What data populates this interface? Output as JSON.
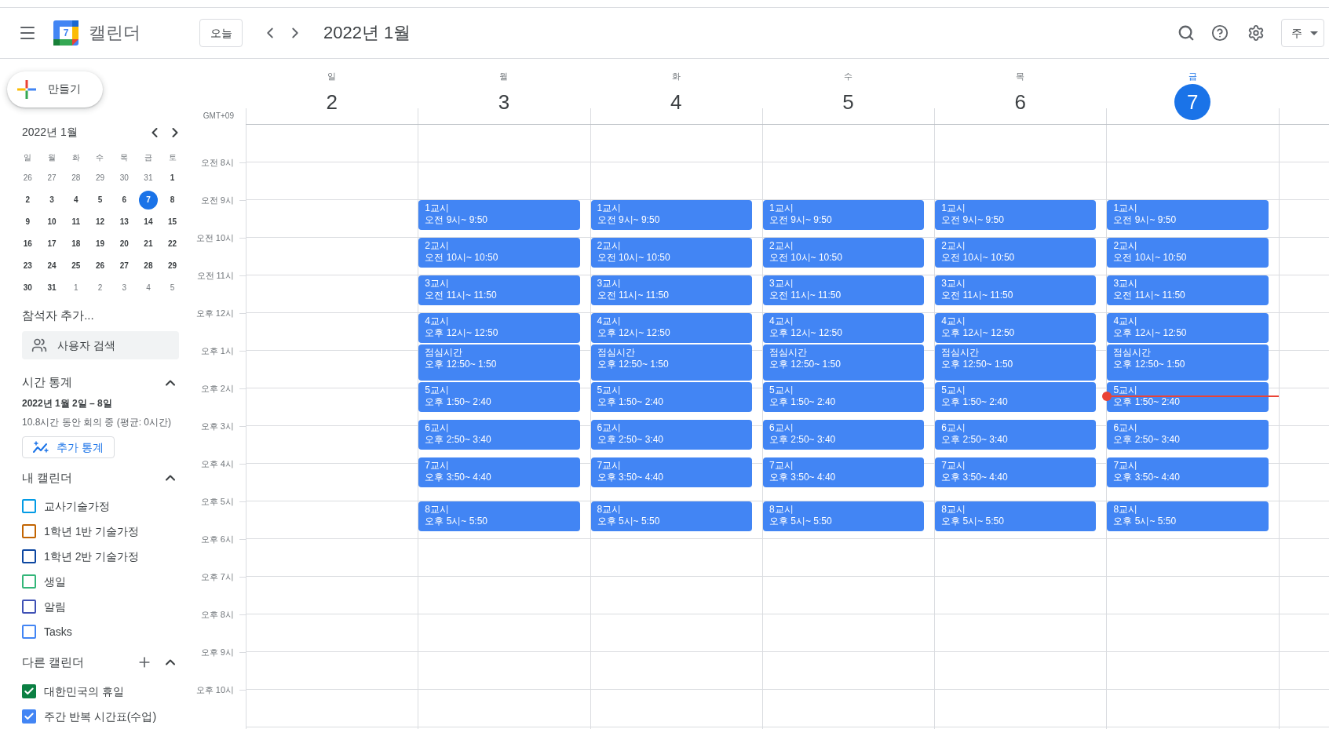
{
  "header": {
    "logo_day": "7",
    "app_name": "캘린더",
    "today_button": "오늘",
    "period": "2022년 1월",
    "view_selector": "주"
  },
  "sidebar": {
    "create_button": "만들기",
    "mini_calendar": {
      "title": "2022년 1월",
      "weekdays": [
        "일",
        "월",
        "화",
        "수",
        "목",
        "금",
        "토"
      ],
      "weeks": [
        [
          {
            "day": "26",
            "in_month": false,
            "selected": false
          },
          {
            "day": "27",
            "in_month": false,
            "selected": false
          },
          {
            "day": "28",
            "in_month": false,
            "selected": false
          },
          {
            "day": "29",
            "in_month": false,
            "selected": false
          },
          {
            "day": "30",
            "in_month": false,
            "selected": false
          },
          {
            "day": "31",
            "in_month": false,
            "selected": false
          },
          {
            "day": "1",
            "in_month": true,
            "selected": false
          }
        ],
        [
          {
            "day": "2",
            "in_month": true,
            "selected": false
          },
          {
            "day": "3",
            "in_month": true,
            "selected": false
          },
          {
            "day": "4",
            "in_month": true,
            "selected": false
          },
          {
            "day": "5",
            "in_month": true,
            "selected": false
          },
          {
            "day": "6",
            "in_month": true,
            "selected": false
          },
          {
            "day": "7",
            "in_month": true,
            "selected": true
          },
          {
            "day": "8",
            "in_month": true,
            "selected": false
          }
        ],
        [
          {
            "day": "9",
            "in_month": true,
            "selected": false
          },
          {
            "day": "10",
            "in_month": true,
            "selected": false
          },
          {
            "day": "11",
            "in_month": true,
            "selected": false
          },
          {
            "day": "12",
            "in_month": true,
            "selected": false
          },
          {
            "day": "13",
            "in_month": true,
            "selected": false
          },
          {
            "day": "14",
            "in_month": true,
            "selected": false
          },
          {
            "day": "15",
            "in_month": true,
            "selected": false
          }
        ],
        [
          {
            "day": "16",
            "in_month": true,
            "selected": false
          },
          {
            "day": "17",
            "in_month": true,
            "selected": false
          },
          {
            "day": "18",
            "in_month": true,
            "selected": false
          },
          {
            "day": "19",
            "in_month": true,
            "selected": false
          },
          {
            "day": "20",
            "in_month": true,
            "selected": false
          },
          {
            "day": "21",
            "in_month": true,
            "selected": false
          },
          {
            "day": "22",
            "in_month": true,
            "selected": false
          }
        ],
        [
          {
            "day": "23",
            "in_month": true,
            "selected": false
          },
          {
            "day": "24",
            "in_month": true,
            "selected": false
          },
          {
            "day": "25",
            "in_month": true,
            "selected": false
          },
          {
            "day": "26",
            "in_month": true,
            "selected": false
          },
          {
            "day": "27",
            "in_month": true,
            "selected": false
          },
          {
            "day": "28",
            "in_month": true,
            "selected": false
          },
          {
            "day": "29",
            "in_month": true,
            "selected": false
          }
        ],
        [
          {
            "day": "30",
            "in_month": true,
            "selected": false
          },
          {
            "day": "31",
            "in_month": true,
            "selected": false
          },
          {
            "day": "1",
            "in_month": false,
            "selected": false
          },
          {
            "day": "2",
            "in_month": false,
            "selected": false
          },
          {
            "day": "3",
            "in_month": false,
            "selected": false
          },
          {
            "day": "4",
            "in_month": false,
            "selected": false
          },
          {
            "day": "5",
            "in_month": false,
            "selected": false
          }
        ]
      ]
    },
    "people_search": {
      "title": "참석자 추가...",
      "placeholder": "사용자 검색"
    },
    "time_insights": {
      "title": "시간 통계",
      "expanded": true,
      "range": "2022년 1월 2일 – 8일",
      "summary": "10.8시간 동안 회의 중 (평균: 0시간)",
      "more_button": "추가 통계"
    },
    "my_calendars": {
      "title": "내 캘린더",
      "expanded": true,
      "items": [
        {
          "label": "교사기술가정",
          "color": "#039be5",
          "checked": false
        },
        {
          "label": "1학년 1반 기술가정",
          "color": "#c26401",
          "checked": false
        },
        {
          "label": "1학년 2반 기술가정",
          "color": "#0d47a1",
          "checked": false
        },
        {
          "label": "생일",
          "color": "#33b679",
          "checked": false
        },
        {
          "label": "알림",
          "color": "#3f51b5",
          "checked": false
        },
        {
          "label": "Tasks",
          "color": "#4285f4",
          "checked": false
        }
      ]
    },
    "other_calendars": {
      "title": "다른 캘린더",
      "expanded": true,
      "items": [
        {
          "label": "대한민국의 휴일",
          "color": "#0b8043",
          "checked": true
        },
        {
          "label": "주간 반복 시간표(수업)",
          "color": "#4285f4",
          "checked": true
        }
      ]
    }
  },
  "week_view": {
    "timezone": "GMT+09",
    "hours": [
      "오전 8시",
      "오전 9시",
      "오전 10시",
      "오전 11시",
      "오후 12시",
      "오후 1시",
      "오후 2시",
      "오후 3시",
      "오후 4시",
      "오후 5시",
      "오후 6시",
      "오후 7시",
      "오후 8시",
      "오후 9시",
      "오후 10시"
    ],
    "days": [
      {
        "weekday": "일",
        "date": "2",
        "today": false
      },
      {
        "weekday": "월",
        "date": "3",
        "today": false,
        "events": [
          {
            "title": "1교시",
            "time": "오전 9시~ 9:50"
          },
          {
            "title": "2교시",
            "time": "오전 10시~ 10:50"
          },
          {
            "title": "3교시",
            "time": "오전 11시~ 11:50"
          },
          {
            "title": "4교시",
            "time": "오후 12시~ 12:50"
          },
          {
            "title": "점심시간",
            "time": "오후 12:50~ 1:50"
          },
          {
            "title": "5교시",
            "time": "오후 1:50~ 2:40"
          },
          {
            "title": "6교시",
            "time": "오후 2:50~ 3:40"
          },
          {
            "title": "7교시",
            "time": "오후 3:50~ 4:40"
          },
          {
            "title": "8교시",
            "time": "오후 5시~ 5:50"
          }
        ]
      },
      {
        "weekday": "화",
        "date": "4",
        "today": false,
        "events": [
          {
            "title": "1교시",
            "time": "오전 9시~ 9:50"
          },
          {
            "title": "2교시",
            "time": "오전 10시~ 10:50"
          },
          {
            "title": "3교시",
            "time": "오전 11시~ 11:50"
          },
          {
            "title": "4교시",
            "time": "오후 12시~ 12:50"
          },
          {
            "title": "점심시간",
            "time": "오후 12:50~ 1:50"
          },
          {
            "title": "5교시",
            "time": "오후 1:50~ 2:40"
          },
          {
            "title": "6교시",
            "time": "오후 2:50~ 3:40"
          },
          {
            "title": "7교시",
            "time": "오후 3:50~ 4:40"
          },
          {
            "title": "8교시",
            "time": "오후 5시~ 5:50"
          }
        ]
      },
      {
        "weekday": "수",
        "date": "5",
        "today": false,
        "events": [
          {
            "title": "1교시",
            "time": "오전 9시~ 9:50"
          },
          {
            "title": "2교시",
            "time": "오전 10시~ 10:50"
          },
          {
            "title": "3교시",
            "time": "오전 11시~ 11:50"
          },
          {
            "title": "4교시",
            "time": "오후 12시~ 12:50"
          },
          {
            "title": "점심시간",
            "time": "오후 12:50~ 1:50"
          },
          {
            "title": "5교시",
            "time": "오후 1:50~ 2:40"
          },
          {
            "title": "6교시",
            "time": "오후 2:50~ 3:40"
          },
          {
            "title": "7교시",
            "time": "오후 3:50~ 4:40"
          },
          {
            "title": "8교시",
            "time": "오후 5시~ 5:50"
          }
        ]
      },
      {
        "weekday": "목",
        "date": "6",
        "today": false,
        "events": [
          {
            "title": "1교시",
            "time": "오전 9시~ 9:50"
          },
          {
            "title": "2교시",
            "time": "오전 10시~ 10:50"
          },
          {
            "title": "3교시",
            "time": "오전 11시~ 11:50"
          },
          {
            "title": "4교시",
            "time": "오후 12시~ 12:50"
          },
          {
            "title": "점심시간",
            "time": "오후 12:50~ 1:50"
          },
          {
            "title": "5교시",
            "time": "오후 1:50~ 2:40"
          },
          {
            "title": "6교시",
            "time": "오후 2:50~ 3:40"
          },
          {
            "title": "7교시",
            "time": "오후 3:50~ 4:40"
          },
          {
            "title": "8교시",
            "time": "오후 5시~ 5:50"
          }
        ]
      },
      {
        "weekday": "금",
        "date": "7",
        "today": true,
        "events": [
          {
            "title": "1교시",
            "time": "오전 9시~ 9:50"
          },
          {
            "title": "2교시",
            "time": "오전 10시~ 10:50"
          },
          {
            "title": "3교시",
            "time": "오전 11시~ 11:50"
          },
          {
            "title": "4교시",
            "time": "오후 12시~ 12:50"
          },
          {
            "title": "점심시간",
            "time": "오후 12:50~ 1:50"
          },
          {
            "title": "5교시",
            "time": "오후 1:50~ 2:40"
          },
          {
            "title": "6교시",
            "time": "오후 2:50~ 3:40"
          },
          {
            "title": "7교시",
            "time": "오후 3:50~ 4:40"
          },
          {
            "title": "8교시",
            "time": "오후 5시~ 5:50"
          }
        ]
      }
    ]
  }
}
